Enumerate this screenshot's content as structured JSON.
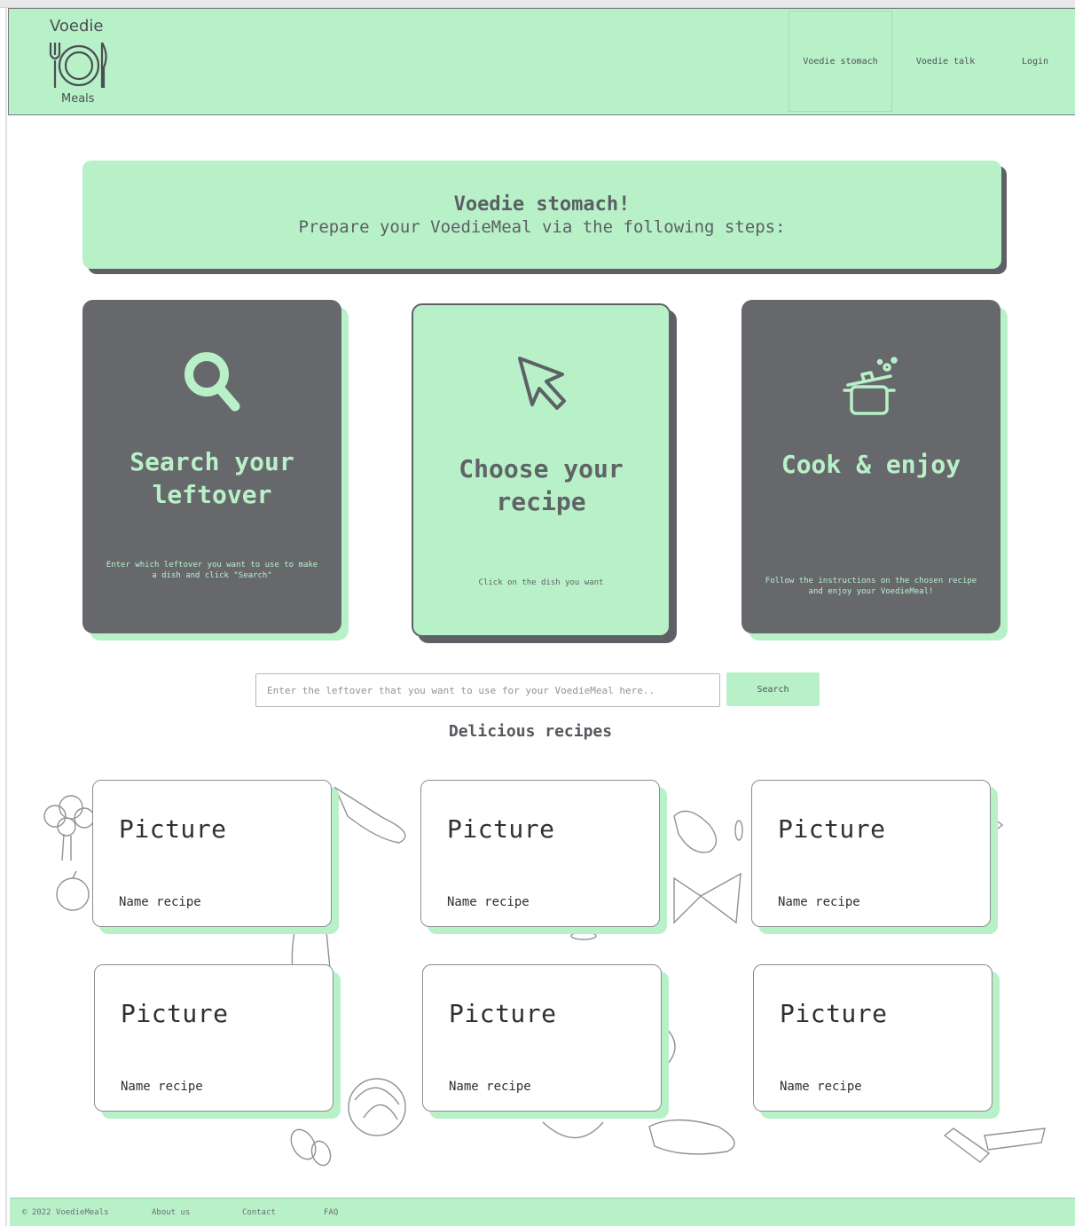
{
  "brand": {
    "top": "Voedie",
    "bottom": "Meals"
  },
  "nav": {
    "items": [
      "Voedie stomach",
      "Voedie talk",
      "Login"
    ]
  },
  "banner": {
    "title": "Voedie stomach!",
    "subtitle": "Prepare your VoedieMeal via the following steps:"
  },
  "steps": [
    {
      "title": "Search your leftover",
      "desc": "Enter which leftover you want to use to make a dish and click \"Search\"",
      "icon": "search-icon"
    },
    {
      "title": "Choose your recipe",
      "desc": "Click on the dish you want",
      "icon": "cursor-icon"
    },
    {
      "title": "Cook & enjoy",
      "desc": "Follow the instructions on the chosen recipe and enjoy your VoedieMeal!",
      "icon": "pot-icon"
    }
  ],
  "search": {
    "placeholder": "Enter the leftover that you want to use for your VoedieMeal here..",
    "button": "Search"
  },
  "recipes_title": "Delicious recipes",
  "recipes": [
    {
      "picture": "Picture",
      "name": "Name recipe"
    },
    {
      "picture": "Picture",
      "name": "Name recipe"
    },
    {
      "picture": "Picture",
      "name": "Name recipe"
    },
    {
      "picture": "Picture",
      "name": "Name recipe"
    },
    {
      "picture": "Picture",
      "name": "Name recipe"
    },
    {
      "picture": "Picture",
      "name": "Name recipe"
    }
  ],
  "footer": {
    "copyright": "© 2022 VoedieMeals",
    "links": [
      "About us",
      "Contact",
      "FAQ"
    ]
  },
  "colors": {
    "mint": "#b8f1c8",
    "slate": "#67686c",
    "text": "#5b5f64"
  }
}
